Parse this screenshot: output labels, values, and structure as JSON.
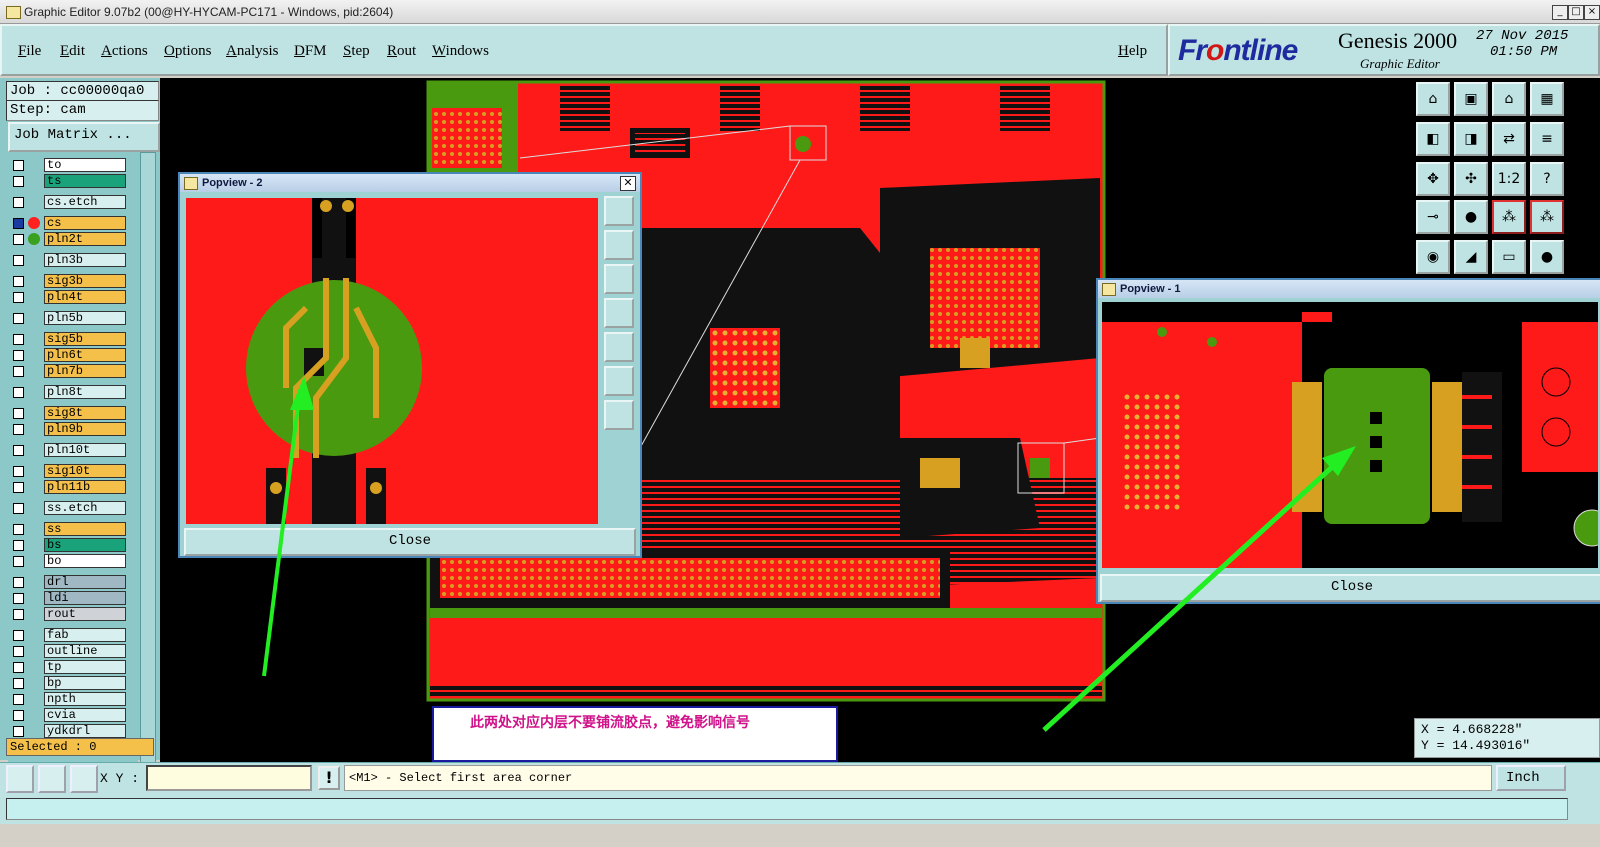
{
  "window": {
    "title": "Graphic Editor 9.07b2 (00@HY-HYCAM-PC171 - Windows, pid:2604)",
    "controls": [
      "_",
      "□",
      "×"
    ]
  },
  "menu": {
    "items": [
      "File",
      "Edit",
      "Actions",
      "Options",
      "Analysis",
      "DFM",
      "Step",
      "Rout",
      "Windows"
    ],
    "help": "Help"
  },
  "brand": {
    "logo_prefix": "Fr",
    "logo_accent": "o",
    "logo_suffix": "ntline",
    "product": "Genesis 2000",
    "subtitle": "Graphic Editor",
    "date": "27 Nov 2015",
    "time": "01:50 PM"
  },
  "left_panel": {
    "job": "Job : cc00000qa0",
    "step": "Step: cam",
    "job_matrix": "Job Matrix ...",
    "layers": [
      {
        "name": "to",
        "color": "#ffffff"
      },
      {
        "name": "ts",
        "color": "#1aa37a"
      },
      {
        "name": "cs.etch",
        "color": "#d8efef"
      },
      {
        "name": "cs",
        "color": "#f5c04a",
        "marker": "#ff2020",
        "active": true
      },
      {
        "name": "pln2t",
        "color": "#f5c04a",
        "marker": "#3aa020"
      },
      {
        "name": "pln3b",
        "color": "#d8efef"
      },
      {
        "name": "sig3b",
        "color": "#f5c04a"
      },
      {
        "name": "pln4t",
        "color": "#f5c04a"
      },
      {
        "name": "pln5b",
        "color": "#d8efef"
      },
      {
        "name": "sig5b",
        "color": "#f5c04a"
      },
      {
        "name": "pln6t",
        "color": "#f5c04a"
      },
      {
        "name": "pln7b",
        "color": "#f5c04a"
      },
      {
        "name": "pln8t",
        "color": "#d8efef"
      },
      {
        "name": "sig8t",
        "color": "#f5c04a"
      },
      {
        "name": "pln9b",
        "color": "#f5c04a"
      },
      {
        "name": "pln10t",
        "color": "#d8efef"
      },
      {
        "name": "sig10t",
        "color": "#f5c04a"
      },
      {
        "name": "pln11b",
        "color": "#f5c04a"
      },
      {
        "name": "ss.etch",
        "color": "#d8efef"
      },
      {
        "name": "ss",
        "color": "#f5c04a"
      },
      {
        "name": "bs",
        "color": "#1aa37a"
      },
      {
        "name": "bo",
        "color": "#ffffff"
      },
      {
        "name": "drl",
        "color": "#9fb8c4"
      },
      {
        "name": "ldi",
        "color": "#9fb8c4"
      },
      {
        "name": "rout",
        "color": "#cfd3d8"
      },
      {
        "name": "fab",
        "color": "#d8efef"
      },
      {
        "name": "outline",
        "color": "#d8efef"
      },
      {
        "name": "tp",
        "color": "#d8efef"
      },
      {
        "name": "bp",
        "color": "#d8efef"
      },
      {
        "name": "npth",
        "color": "#d8efef"
      },
      {
        "name": "cvia",
        "color": "#d8efef"
      },
      {
        "name": "ydkdrl",
        "color": "#d8efef"
      }
    ],
    "selected": "Selected : 0"
  },
  "popview2": {
    "title": "Popview - 2",
    "close": "Close"
  },
  "popview1": {
    "title": "Popview - 1",
    "close": "Close"
  },
  "right_toolbar": {
    "labels": [
      "1:2",
      "?"
    ],
    "coord_x": "X = 4.668228\"",
    "coord_y": "Y = 14.493016\""
  },
  "annotation": {
    "text": "此两处对应内层不要铺流胶点，避免影响信号"
  },
  "bottom": {
    "xy_label": "X Y :",
    "xy_value": "",
    "warn": "!",
    "prompt": "<M1> - Select first area corner",
    "unit": "Inch"
  },
  "colors": {
    "panel": "#bfe3e3",
    "canvas": "#000000",
    "copper_red": "#ff1a1a",
    "plane_green": "#4a9a10",
    "pad_yellow": "#d8a020",
    "arrow_green": "#22ee22"
  }
}
